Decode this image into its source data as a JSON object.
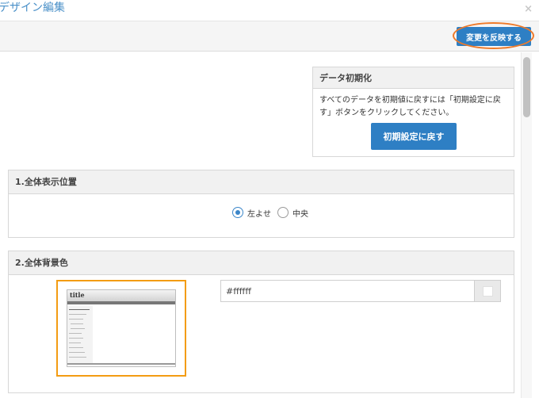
{
  "dialog": {
    "title": "デザイン編集",
    "close_icon": "×"
  },
  "toolbar": {
    "apply_label": "変更を反映する"
  },
  "reset_panel": {
    "heading": "データ初期化",
    "description": "すべてのデータを初期値に戻すには「初期設定に戻す」ボタンをクリックしてください。",
    "button_label": "初期設定に戻す"
  },
  "sections": {
    "position": {
      "heading": "1.全体表示位置",
      "options": [
        {
          "label": "左よせ",
          "checked": true
        },
        {
          "label": "中央",
          "checked": false
        }
      ]
    },
    "background": {
      "heading": "2.全体背景色",
      "thumbnail_title": "title",
      "color_value": "#ffffff",
      "swatch_color": "#ffffff"
    }
  },
  "colors": {
    "accent": "#2e7fc4",
    "highlight": "#ee7a2a",
    "selection_border": "#f39c12"
  }
}
